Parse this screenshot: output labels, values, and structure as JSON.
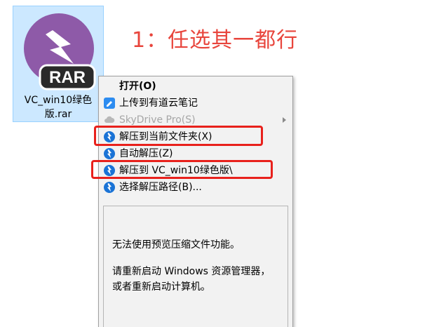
{
  "annotation": {
    "text": "1：任选其一都行",
    "color": "#e8453c"
  },
  "file": {
    "name_line1": "VC_win10绿色",
    "name_line2": "版.rar",
    "badge": "RAR",
    "icon": "winrar-book-icon"
  },
  "menu": {
    "items": [
      {
        "label": "打开(O)",
        "icon": "",
        "bold": true,
        "disabled": false
      },
      {
        "label": "上传到有道云笔记",
        "icon": "youdao-note-icon",
        "bold": false,
        "disabled": false
      },
      {
        "label": "SkyDrive Pro(S)",
        "icon": "cloud-icon",
        "bold": false,
        "disabled": true,
        "submenu": true
      },
      {
        "label": "解压到当前文件夹(X)",
        "icon": "extract-icon",
        "bold": false,
        "disabled": false,
        "highlighted": true
      },
      {
        "label": "自动解压(Z)",
        "icon": "extract-icon",
        "bold": false,
        "disabled": false
      },
      {
        "label": "解压到 VC_win10绿色版\\",
        "icon": "extract-icon",
        "bold": false,
        "disabled": false,
        "highlighted": true
      },
      {
        "label": "选择解压路径(B)...",
        "icon": "extract-icon",
        "bold": false,
        "disabled": false
      }
    ]
  },
  "preview": {
    "line1": "无法使用预览压缩文件功能。",
    "line2": "请重新启动 Windows 资源管理器，",
    "line3": "或者重新启动计算机。"
  },
  "colors": {
    "highlight": "#e8211c",
    "selection_bg": "#cce8ff",
    "accent_blue": "#1a73d6",
    "rar_purple": "#8e5aa8"
  }
}
